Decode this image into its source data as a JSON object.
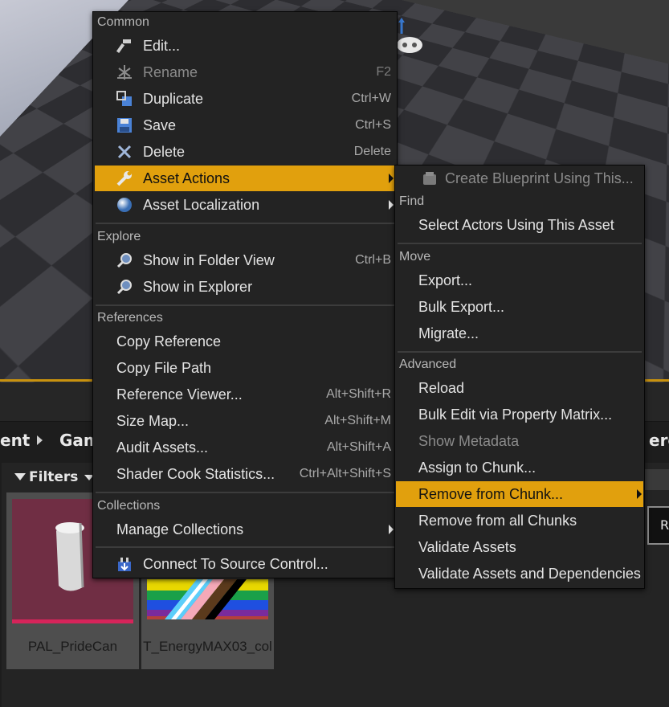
{
  "main_menu": {
    "sections": {
      "common": "Common",
      "explore": "Explore",
      "references": "References",
      "collections": "Collections"
    },
    "items": {
      "edit": {
        "label": "Edit...",
        "shortcut": "",
        "icon": "hammer-icon"
      },
      "rename": {
        "label": "Rename",
        "shortcut": "F2",
        "icon": "rename-icon"
      },
      "duplicate": {
        "label": "Duplicate",
        "shortcut": "Ctrl+W",
        "icon": "duplicate-icon"
      },
      "save": {
        "label": "Save",
        "shortcut": "Ctrl+S",
        "icon": "save-icon"
      },
      "delete": {
        "label": "Delete",
        "shortcut": "Delete",
        "icon": "delete-icon"
      },
      "asset_actions": {
        "label": "Asset Actions",
        "icon": "wrench-icon"
      },
      "asset_localization": {
        "label": "Asset Localization",
        "icon": "globe-icon"
      },
      "show_folder": {
        "label": "Show in Folder View",
        "shortcut": "Ctrl+B",
        "icon": "magnifier-icon"
      },
      "show_explorer": {
        "label": "Show in Explorer",
        "icon": "magnifier-icon"
      },
      "copy_reference": {
        "label": "Copy Reference"
      },
      "copy_file_path": {
        "label": "Copy File Path"
      },
      "reference_viewer": {
        "label": "Reference Viewer...",
        "shortcut": "Alt+Shift+R"
      },
      "size_map": {
        "label": "Size Map...",
        "shortcut": "Alt+Shift+M"
      },
      "audit_assets": {
        "label": "Audit Assets...",
        "shortcut": "Alt+Shift+A"
      },
      "shader_cook": {
        "label": "Shader Cook Statistics...",
        "shortcut": "Ctrl+Alt+Shift+S"
      },
      "manage_collections": {
        "label": "Manage Collections"
      },
      "connect_source_control": {
        "label": "Connect To Source Control...",
        "icon": "source-control-icon"
      }
    }
  },
  "sub_menu": {
    "sections": {
      "find": "Find",
      "move": "Move",
      "advanced": "Advanced"
    },
    "items": {
      "create_blueprint": {
        "label": "Create Blueprint Using This...",
        "icon": "blueprint-icon"
      },
      "select_actors": {
        "label": "Select Actors Using This Asset"
      },
      "export": {
        "label": "Export..."
      },
      "bulk_export": {
        "label": "Bulk Export..."
      },
      "migrate": {
        "label": "Migrate..."
      },
      "reload": {
        "label": "Reload"
      },
      "bulk_edit": {
        "label": "Bulk Edit via Property Matrix..."
      },
      "show_metadata": {
        "label": "Show Metadata"
      },
      "assign_chunk": {
        "label": "Assign to Chunk..."
      },
      "remove_chunk": {
        "label": "Remove from Chunk..."
      },
      "remove_all_chunks": {
        "label": "Remove from all Chunks"
      },
      "validate_assets": {
        "label": "Validate Assets"
      },
      "validate_deps": {
        "label": "Validate Assets and Dependencies"
      }
    }
  },
  "content_browser": {
    "breadcrumb_left": "ent",
    "breadcrumb_game": "Gam",
    "breadcrumb_right": "erg",
    "filters_label": "Filters",
    "right_button_label": "R",
    "assets": [
      {
        "name": "PAL_PrideCan"
      },
      {
        "name": "T_EnergyMAX03_col"
      }
    ]
  },
  "colors": {
    "highlight": "#e1a00d",
    "menu_bg": "#232323",
    "viewport_border": "#c9920e"
  }
}
